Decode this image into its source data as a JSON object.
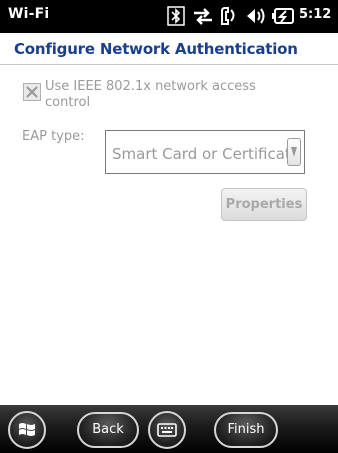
{
  "status_bar": {
    "title": "Wi-Fi",
    "time": "5:12",
    "icons": [
      "bluetooth-icon",
      "data-transfer-icon",
      "phone-icon",
      "speaker-icon",
      "battery-icon"
    ]
  },
  "header": {
    "title": "Configure Network Authentication"
  },
  "form": {
    "checkbox_label": "Use IEEE 802.1x network access control",
    "checkbox_checked": true,
    "eap_label": "EAP type:",
    "eap_value": "Smart Card or Certificate",
    "properties_label": "Properties"
  },
  "bottom_bar": {
    "back_label": "Back",
    "finish_label": "Finish",
    "start_icon": "windows-logo-icon",
    "keyboard_icon": "keyboard-icon"
  },
  "colors": {
    "title": "#1b3f8f",
    "disabled_text": "#9a9a9a",
    "status_bar": "#000000"
  }
}
